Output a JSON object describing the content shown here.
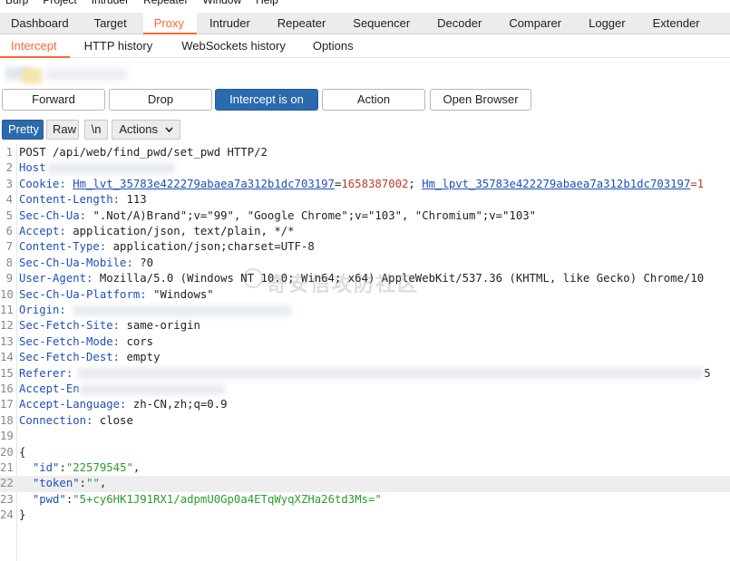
{
  "menubar": [
    "Burp",
    "Project",
    "Intruder",
    "Repeater",
    "Window",
    "Help"
  ],
  "main_tabs": [
    "Dashboard",
    "Target",
    "Proxy",
    "Intruder",
    "Repeater",
    "Sequencer",
    "Decoder",
    "Comparer",
    "Logger",
    "Extender"
  ],
  "sub_tabs": [
    "Intercept",
    "HTTP history",
    "WebSockets history",
    "Options"
  ],
  "actions": {
    "forward": "Forward",
    "drop": "Drop",
    "intercept": "Intercept is on",
    "action": "Action",
    "open_browser": "Open Browser"
  },
  "editor": {
    "pretty": "Pretty",
    "raw": "Raw",
    "newline": "\\n",
    "actions": "Actions"
  },
  "request": {
    "l1": "POST /api/web/find_pwd/set_pwd HTTP/2",
    "l2_key": "Host",
    "l3_key": "Cookie:",
    "l3_c1": "Hm_lvt_35783e422279abaea7a312b1dc703197",
    "l3_eq1": "=",
    "l3_v1": "1658387002",
    "l3_sep": "; ",
    "l3_c2": "Hm_lpvt_35783e422279abaea7a312b1dc703197",
    "l3_eq2": "=1",
    "l4_key": "Content-Length:",
    "l4_val": " 113",
    "l5_key": "Sec-Ch-Ua:",
    "l5_val": " \".Not/A)Brand\";v=\"99\", \"Google Chrome\";v=\"103\", \"Chromium\";v=\"103\"",
    "l6_key": "Accept:",
    "l6_val": " application/json, text/plain, */*",
    "l7_key": "Content-Type:",
    "l7_val": " application/json;charset=UTF-8",
    "l8_key": "Sec-Ch-Ua-Mobile:",
    "l8_val": " ?0",
    "l9_key": "User-Agent:",
    "l9_val": " Mozilla/5.0 (Windows NT 10.0; Win64; x64) AppleWebKit/537.36 (KHTML, like Gecko) Chrome/10",
    "l10_key": "Sec-Ch-Ua-Platform:",
    "l10_val": " \"Windows\"",
    "l11_key": "Origin:",
    "l12_key": "Sec-Fetch-Site:",
    "l12_val": " same-origin",
    "l13_key": "Sec-Fetch-Mode:",
    "l13_val": " cors",
    "l14_key": "Sec-Fetch-Dest:",
    "l14_val": " empty",
    "l15_key": "Referer:",
    "l15_tail": "5",
    "l16_key": "Accept-En",
    "l17_key": "Accept-Language:",
    "l17_val": " zh-CN,zh;q=0.9",
    "l18_key": "Connection:",
    "l18_val": " close",
    "l20": "{",
    "l21_key": "\"id\"",
    "l21_colon": ":",
    "l21_val": "\"22579545\"",
    "l21_comma": ",",
    "l22_key": "\"token\"",
    "l22_colon": ":",
    "l22_val": "\"\"",
    "l22_comma": ",",
    "l23_key": "\"pwd\"",
    "l23_colon": ":",
    "l23_val": "\"5+cy6HK1J91RX1/adpmU0Gp0a4ETqWyqXZHa26td3Ms=\"",
    "l24": "}"
  },
  "line_numbers": [
    "1",
    "2",
    "3",
    "4",
    "5",
    "6",
    "7",
    "8",
    "9",
    "10",
    "11",
    "12",
    "13",
    "14",
    "15",
    "16",
    "17",
    "18",
    "19",
    "20",
    "21",
    "22",
    "23",
    "24"
  ],
  "watermark": "奇安信攻防社区",
  "colors": {
    "accent": "#ff6633",
    "primary_button": "#2a6aad",
    "header_key": "#1f4fb8",
    "json_string": "#2a9d2a",
    "cookie_value": "#c0392b"
  }
}
